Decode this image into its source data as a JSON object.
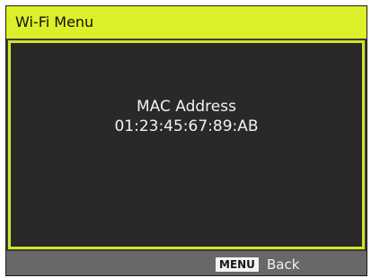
{
  "header": {
    "title": "Wi-Fi Menu"
  },
  "main": {
    "mac_label": "MAC Address",
    "mac_value": "01:23:45:67:89:AB"
  },
  "footer": {
    "menu_key": "MENU",
    "back_label": "Back"
  },
  "colors": {
    "accent": "#dcef2a",
    "panel_border": "#cfe62a",
    "panel_background": "#2b2828",
    "footer_background": "#6a6767"
  }
}
